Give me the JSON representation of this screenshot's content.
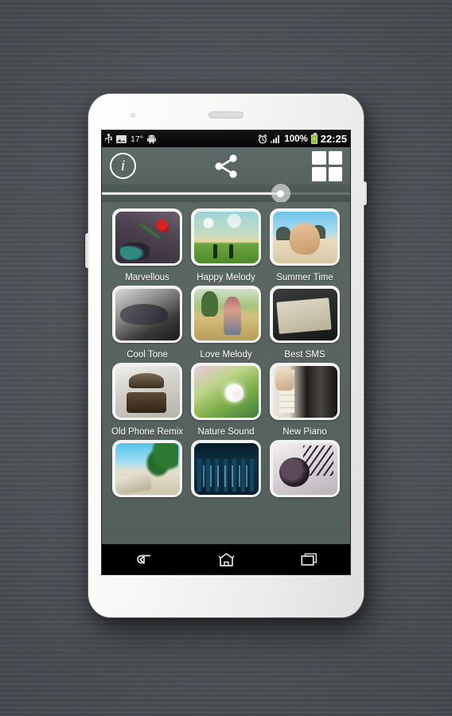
{
  "device": {
    "kind": "white-android-smartphone",
    "background": "#4b5056"
  },
  "statusbar": {
    "left_icons": [
      "usb-icon",
      "screenshot-image-icon",
      "android-robot-icon"
    ],
    "temperature": "17°",
    "alarm_icon": "alarm-clock-icon",
    "signal_icon": "signal-bars-icon",
    "battery_percent": "100%",
    "battery_icon": "battery-charging-icon",
    "time": "22:25",
    "bg_color": "#050505",
    "text_color": "#f2f2f2"
  },
  "toolbar": {
    "info_label": "i",
    "info_icon": "info-circle-icon",
    "share_icon": "share-nodes-icon",
    "grid_icon": "grid-view-icon",
    "bg_color": "#5d6a69"
  },
  "seekbar": {
    "value_percent": 72,
    "track_color": "#f2f2f2",
    "thumb_color": "#ffffff"
  },
  "grid": {
    "bg_color": "#5b6763",
    "tiles": [
      {
        "label": "Marvellous",
        "art": "art-rose",
        "art_name": "red-rose-thumbnail"
      },
      {
        "label": "Happy Melody",
        "art": "art-sky",
        "art_name": "sky-field-silhouette-thumbnail"
      },
      {
        "label": "Summer Time",
        "art": "art-beach",
        "art_name": "sandy-hands-beach-thumbnail"
      },
      {
        "label": "Cool Tone",
        "art": "art-cooltone",
        "art_name": "dark-glossy-object-thumbnail"
      },
      {
        "label": "Love Melody",
        "art": "art-lovemelody",
        "art_name": "couple-in-field-thumbnail"
      },
      {
        "label": "Best SMS",
        "art": "art-bestsms",
        "art_name": "sms-note-thumbnail"
      },
      {
        "label": "Old Phone Remix",
        "art": "art-oldphone",
        "art_name": "antique-telephone-thumbnail"
      },
      {
        "label": "Nature Sound",
        "art": "art-nature",
        "art_name": "dandelion-flower-thumbnail"
      },
      {
        "label": "New Piano",
        "art": "art-piano",
        "art_name": "piano-keys-thumbnail"
      },
      {
        "label": "",
        "art": "art-tropical",
        "art_name": "tropical-beach-thumbnail"
      },
      {
        "label": "",
        "art": "art-city",
        "art_name": "blue-night-city-thumbnail"
      },
      {
        "label": "",
        "art": "art-headphone",
        "art_name": "headphones-thumbnail"
      }
    ]
  },
  "navbar": {
    "back_icon": "back-arrow-icon",
    "home_icon": "home-icon",
    "recents_icon": "recent-apps-icon",
    "bg_color": "#000000"
  }
}
